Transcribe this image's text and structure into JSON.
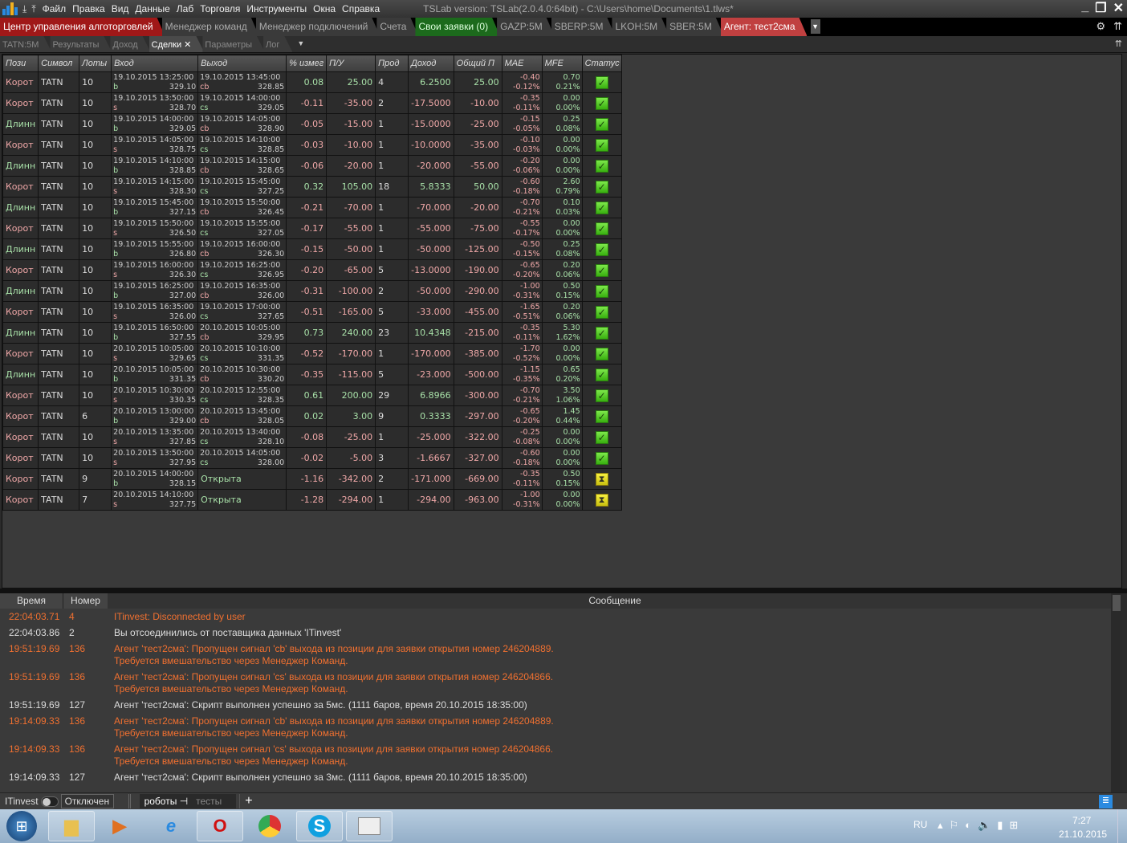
{
  "menu": {
    "items": [
      "Файл",
      "Правка",
      "Вид",
      "Данные",
      "Лаб",
      "Торговля",
      "Инструменты",
      "Окна",
      "Справка"
    ],
    "version": "TSLab version:  TSLab(2.0.4.0:64bit) - C:\\Users\\home\\Documents\\1.tlws*"
  },
  "tabs1": [
    {
      "label": "Центр управления алготорговлей",
      "style": "red"
    },
    {
      "label": "Менеджер команд"
    },
    {
      "label": "Менеджер подключений"
    },
    {
      "label": "Счета"
    },
    {
      "label": "Свои заявки (0)",
      "style": "green"
    },
    {
      "label": "GAZP:5M"
    },
    {
      "label": "SBERP:5M"
    },
    {
      "label": "LKOH:5M"
    },
    {
      "label": "SBER:5M"
    },
    {
      "label": "Агент: тест2сма",
      "style": "agent"
    }
  ],
  "tabs2": [
    {
      "label": "TATN:5M"
    },
    {
      "label": "Результаты"
    },
    {
      "label": "Доход"
    },
    {
      "label": "Сделки ✕",
      "active": true
    },
    {
      "label": "Параметры"
    },
    {
      "label": "Лог"
    }
  ],
  "columns": [
    "Пози",
    "Символ",
    "Лоты",
    "Вход",
    "Выход",
    "% измег",
    "П/У",
    "Прод",
    "Доход",
    "Общий П",
    "MAE",
    "MFE",
    "Статус"
  ],
  "colors": {
    "positive": "#a8e0a8",
    "negative": "#f0a8a8",
    "warning": "#f07030"
  },
  "rows": [
    [
      "Корот",
      "TATN",
      "10",
      "19.10.2015 13:25:00",
      "b",
      "329.10",
      "19.10.2015 13:45:00",
      "cb",
      "328.85",
      "0.08",
      "25.00",
      "4",
      "6.2500",
      "25.00",
      "-0.40",
      "-0.12%",
      "0.70",
      "0.21%",
      "done"
    ],
    [
      "Корот",
      "TATN",
      "10",
      "19.10.2015 13:50:00",
      "s",
      "328.70",
      "19.10.2015 14:00:00",
      "cs",
      "329.05",
      "-0.11",
      "-35.00",
      "2",
      "-17.5000",
      "-10.00",
      "-0.35",
      "-0.11%",
      "0.00",
      "0.00%",
      "done"
    ],
    [
      "Длинн",
      "TATN",
      "10",
      "19.10.2015 14:00:00",
      "b",
      "329.05",
      "19.10.2015 14:05:00",
      "cb",
      "328.90",
      "-0.05",
      "-15.00",
      "1",
      "-15.0000",
      "-25.00",
      "-0.15",
      "-0.05%",
      "0.25",
      "0.08%",
      "done"
    ],
    [
      "Корот",
      "TATN",
      "10",
      "19.10.2015 14:05:00",
      "s",
      "328.75",
      "19.10.2015 14:10:00",
      "cs",
      "328.85",
      "-0.03",
      "-10.00",
      "1",
      "-10.0000",
      "-35.00",
      "-0.10",
      "-0.03%",
      "0.00",
      "0.00%",
      "done"
    ],
    [
      "Длинн",
      "TATN",
      "10",
      "19.10.2015 14:10:00",
      "b",
      "328.85",
      "19.10.2015 14:15:00",
      "cb",
      "328.65",
      "-0.06",
      "-20.00",
      "1",
      "-20.000",
      "-55.00",
      "-0.20",
      "-0.06%",
      "0.00",
      "0.00%",
      "done"
    ],
    [
      "Корот",
      "TATN",
      "10",
      "19.10.2015 14:15:00",
      "s",
      "328.30",
      "19.10.2015 15:45:00",
      "cs",
      "327.25",
      "0.32",
      "105.00",
      "18",
      "5.8333",
      "50.00",
      "-0.60",
      "-0.18%",
      "2.60",
      "0.79%",
      "done"
    ],
    [
      "Длинн",
      "TATN",
      "10",
      "19.10.2015 15:45:00",
      "b",
      "327.15",
      "19.10.2015 15:50:00",
      "cb",
      "326.45",
      "-0.21",
      "-70.00",
      "1",
      "-70.000",
      "-20.00",
      "-0.70",
      "-0.21%",
      "0.10",
      "0.03%",
      "done"
    ],
    [
      "Корот",
      "TATN",
      "10",
      "19.10.2015 15:50:00",
      "s",
      "326.50",
      "19.10.2015 15:55:00",
      "cs",
      "327.05",
      "-0.17",
      "-55.00",
      "1",
      "-55.000",
      "-75.00",
      "-0.55",
      "-0.17%",
      "0.00",
      "0.00%",
      "done"
    ],
    [
      "Длинн",
      "TATN",
      "10",
      "19.10.2015 15:55:00",
      "b",
      "326.80",
      "19.10.2015 16:00:00",
      "cb",
      "326.30",
      "-0.15",
      "-50.00",
      "1",
      "-50.000",
      "-125.00",
      "-0.50",
      "-0.15%",
      "0.25",
      "0.08%",
      "done"
    ],
    [
      "Корот",
      "TATN",
      "10",
      "19.10.2015 16:00:00",
      "s",
      "326.30",
      "19.10.2015 16:25:00",
      "cs",
      "326.95",
      "-0.20",
      "-65.00",
      "5",
      "-13.0000",
      "-190.00",
      "-0.65",
      "-0.20%",
      "0.20",
      "0.06%",
      "done"
    ],
    [
      "Длинн",
      "TATN",
      "10",
      "19.10.2015 16:25:00",
      "b",
      "327.00",
      "19.10.2015 16:35:00",
      "cb",
      "326.00",
      "-0.31",
      "-100.00",
      "2",
      "-50.000",
      "-290.00",
      "-1.00",
      "-0.31%",
      "0.50",
      "0.15%",
      "done"
    ],
    [
      "Корот",
      "TATN",
      "10",
      "19.10.2015 16:35:00",
      "s",
      "326.00",
      "19.10.2015 17:00:00",
      "cs",
      "327.65",
      "-0.51",
      "-165.00",
      "5",
      "-33.000",
      "-455.00",
      "-1.65",
      "-0.51%",
      "0.20",
      "0.06%",
      "done"
    ],
    [
      "Длинн",
      "TATN",
      "10",
      "19.10.2015 16:50:00",
      "b",
      "327.55",
      "20.10.2015 10:05:00",
      "cb",
      "329.95",
      "0.73",
      "240.00",
      "23",
      "10.4348",
      "-215.00",
      "-0.35",
      "-0.11%",
      "5.30",
      "1.62%",
      "done"
    ],
    [
      "Корот",
      "TATN",
      "10",
      "20.10.2015 10:05:00",
      "s",
      "329.65",
      "20.10.2015 10:10:00",
      "cs",
      "331.35",
      "-0.52",
      "-170.00",
      "1",
      "-170.000",
      "-385.00",
      "-1.70",
      "-0.52%",
      "0.00",
      "0.00%",
      "done"
    ],
    [
      "Длинн",
      "TATN",
      "10",
      "20.10.2015 10:05:00",
      "b",
      "331.35",
      "20.10.2015 10:30:00",
      "cb",
      "330.20",
      "-0.35",
      "-115.00",
      "5",
      "-23.000",
      "-500.00",
      "-1.15",
      "-0.35%",
      "0.65",
      "0.20%",
      "done"
    ],
    [
      "Корот",
      "TATN",
      "10",
      "20.10.2015 10:30:00",
      "s",
      "330.35",
      "20.10.2015 12:55:00",
      "cs",
      "328.35",
      "0.61",
      "200.00",
      "29",
      "6.8966",
      "-300.00",
      "-0.70",
      "-0.21%",
      "3.50",
      "1.06%",
      "done"
    ],
    [
      "Корот",
      "TATN",
      "6",
      "20.10.2015 13:00:00",
      "b",
      "329.00",
      "20.10.2015 13:45:00",
      "cb",
      "328.05",
      "0.02",
      "3.00",
      "9",
      "0.3333",
      "-297.00",
      "-0.65",
      "-0.20%",
      "1.45",
      "0.44%",
      "done"
    ],
    [
      "Корот",
      "TATN",
      "10",
      "20.10.2015 13:35:00",
      "s",
      "327.85",
      "20.10.2015 13:40:00",
      "cs",
      "328.10",
      "-0.08",
      "-25.00",
      "1",
      "-25.000",
      "-322.00",
      "-0.25",
      "-0.08%",
      "0.00",
      "0.00%",
      "done"
    ],
    [
      "Корот",
      "TATN",
      "10",
      "20.10.2015 13:50:00",
      "s",
      "327.95",
      "20.10.2015 14:05:00",
      "cs",
      "328.00",
      "-0.02",
      "-5.00",
      "3",
      "-1.6667",
      "-327.00",
      "-0.60",
      "-0.18%",
      "0.00",
      "0.00%",
      "done"
    ],
    [
      "Корот",
      "TATN",
      "9",
      "20.10.2015 14:00:00",
      "b",
      "328.15",
      "Открыта",
      "",
      "",
      "-1.16",
      "-342.00",
      "2",
      "-171.000",
      "-669.00",
      "-0.35",
      "-0.11%",
      "0.50",
      "0.15%",
      "open"
    ],
    [
      "Корот",
      "TATN",
      "7",
      "20.10.2015 14:10:00",
      "s",
      "327.75",
      "Открыта",
      "",
      "",
      "-1.28",
      "-294.00",
      "1",
      "-294.00",
      "-963.00",
      "-1.00",
      "-0.31%",
      "0.00",
      "0.00%",
      "open"
    ]
  ],
  "log": {
    "headers": [
      "Время",
      "Номер",
      "Сообщение"
    ],
    "rows": [
      {
        "time": "22:04:03.71",
        "num": "4",
        "msg": "ITinvest: Disconnected by user",
        "level": "warn"
      },
      {
        "time": "22:04:03.86",
        "num": "2",
        "msg": "Вы отсоединились от поставщика данных 'ITinvest'",
        "level": "info"
      },
      {
        "time": "19:51:19.69",
        "num": "136",
        "msg": "Агент 'тест2сма': Пропущен сигнал 'cb' выхода из позиции для заявки открытия номер 246204889.\nТребуется вмешательство через Менеджер Команд.",
        "level": "warn"
      },
      {
        "time": "19:51:19.69",
        "num": "136",
        "msg": "Агент 'тест2сма': Пропущен сигнал 'cs' выхода из позиции для заявки открытия номер 246204866.\nТребуется вмешательство через Менеджер Команд.",
        "level": "warn"
      },
      {
        "time": "19:51:19.69",
        "num": "127",
        "msg": "Агент 'тест2сма': Скрипт выполнен успешно за 5мс. (1111 баров, время 20.10.2015 18:35:00)",
        "level": "info"
      },
      {
        "time": "19:14:09.33",
        "num": "136",
        "msg": "Агент 'тест2сма': Пропущен сигнал 'cb' выхода из позиции для заявки открытия номер 246204889.\nТребуется вмешательство через Менеджер Команд.",
        "level": "warn"
      },
      {
        "time": "19:14:09.33",
        "num": "136",
        "msg": "Агент 'тест2сма': Пропущен сигнал 'cs' выхода из позиции для заявки открытия номер 246204866.\nТребуется вмешательство через Менеджер Команд.",
        "level": "warn"
      },
      {
        "time": "19:14:09.33",
        "num": "127",
        "msg": "Агент 'тест2сма': Скрипт выполнен успешно за 3мс. (1111 баров, время 20.10.2015 18:35:00)",
        "level": "info"
      }
    ]
  },
  "status": {
    "provider": "ITinvest",
    "state": "Отключен",
    "tab_robots": "роботы",
    "tab_tests": "тесты",
    "add": "+"
  },
  "taskbar": {
    "lang": "RU",
    "time": "7:27",
    "date": "21.10.2015"
  }
}
